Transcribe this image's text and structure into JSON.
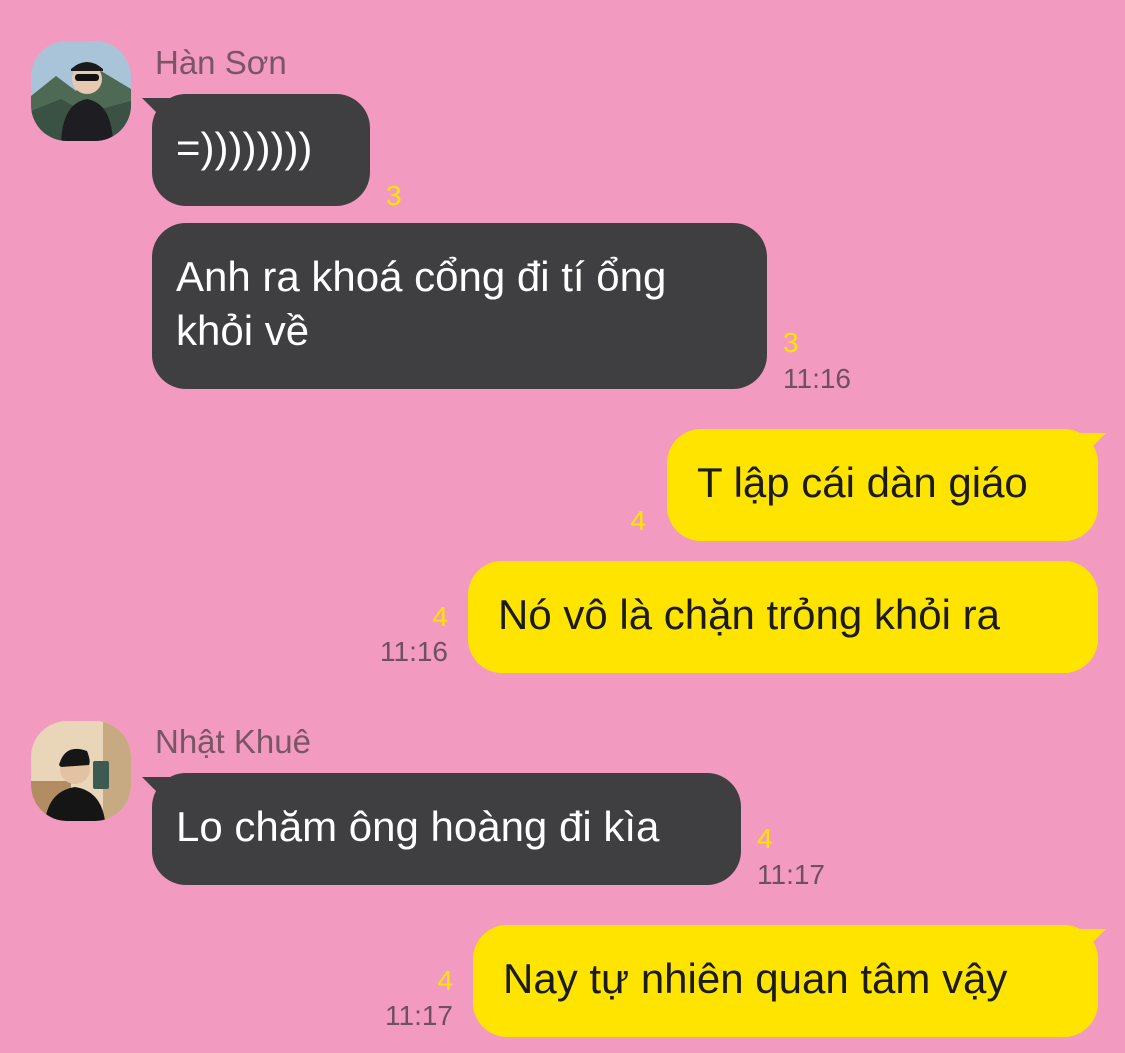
{
  "colors": {
    "background": "#F39AC1",
    "incoming_bubble": "#3F3F41",
    "outgoing_bubble": "#FFE400",
    "unread_count": "#FFE400",
    "timestamp": "#6E5160"
  },
  "conversation": {
    "group1": {
      "sender": "Hàn Sơn",
      "messages": [
        {
          "text": "=))))))))",
          "unread": "3",
          "time": ""
        },
        {
          "text": "Anh ra khoá cổng đi tí ổng\nkhỏi về",
          "unread": "3",
          "time": "11:16"
        }
      ]
    },
    "group2": {
      "messages": [
        {
          "text": "T lập cái dàn giáo",
          "unread": "4",
          "time": ""
        },
        {
          "text": "Nó vô là chặn trỏng khỏi ra",
          "unread": "4",
          "time": "11:16"
        }
      ]
    },
    "group3": {
      "sender": "Nhật Khuê",
      "messages": [
        {
          "text": "Lo chăm ông hoàng đi kìa",
          "unread": "4",
          "time": "11:17"
        }
      ]
    },
    "group4": {
      "messages": [
        {
          "text": "Nay tự nhiên quan tâm vậy",
          "unread": "4",
          "time": "11:17"
        }
      ]
    }
  }
}
